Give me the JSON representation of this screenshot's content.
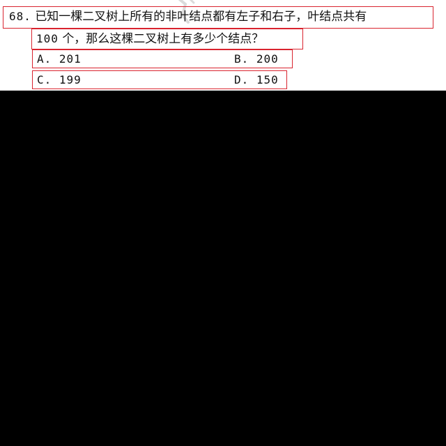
{
  "question": {
    "number": "68.",
    "line1_text": "已知一棵二叉树上所有的非叶结点都有左子和右子，叶结点共有",
    "line2_count": "100",
    "line2_text": "个，那么这棵二叉树上有多少个结点？"
  },
  "options": [
    {
      "label": "A.",
      "value": "201"
    },
    {
      "label": "B.",
      "value": "200"
    },
    {
      "label": "C.",
      "value": "199"
    },
    {
      "label": "D.",
      "value": "150"
    }
  ],
  "colors": {
    "highlight_box": "#d9232e",
    "paper": "#ffffff",
    "background": "#000000",
    "text": "#111111"
  },
  "icons": {
    "watermark": "watermark-icon"
  }
}
